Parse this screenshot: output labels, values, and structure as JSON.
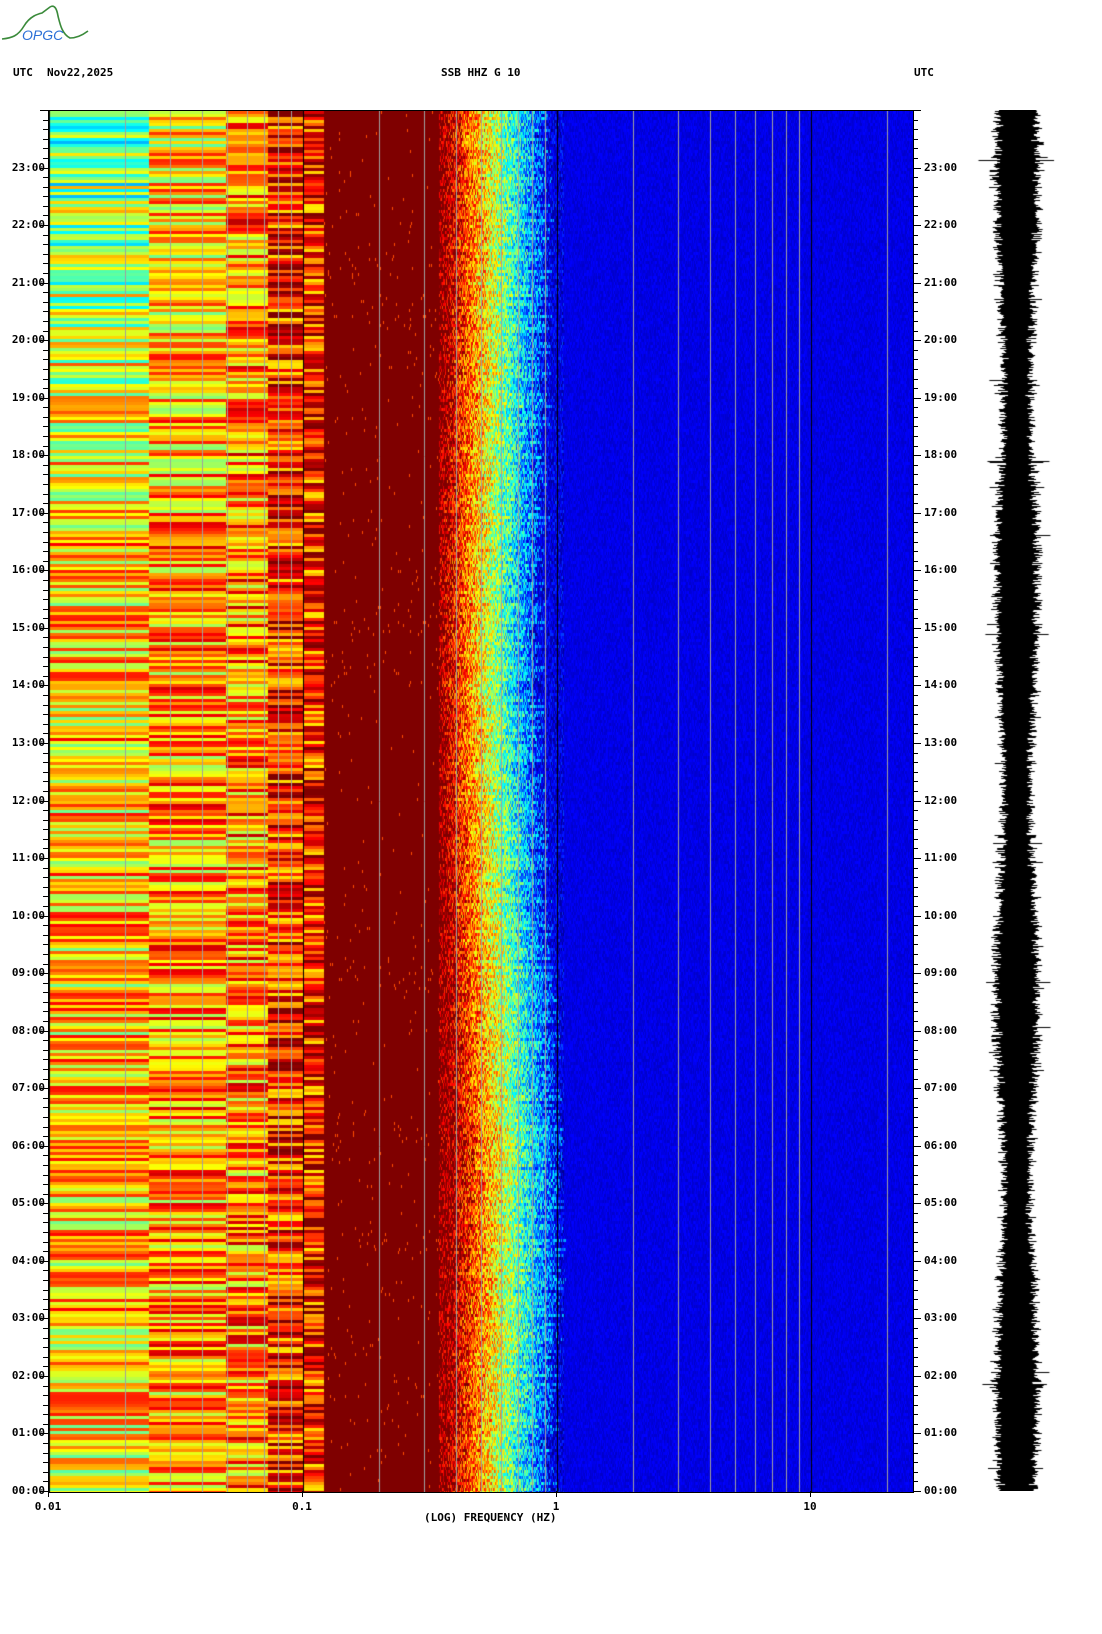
{
  "logo": {
    "text": "OPGC"
  },
  "header": {
    "left_tz": "UTC",
    "date": "Nov22,2025",
    "title": "SSB HHZ G 10",
    "right_tz": "UTC"
  },
  "colors": {
    "low": "#00008f",
    "high": "#800000",
    "trace": "#000000"
  },
  "chart_data": {
    "type": "heatmap",
    "title": "SSB HHZ G 10",
    "date": "Nov22,2025",
    "xlabel": "(LOG) FREQUENCY (HZ)",
    "ylabel": "UTC",
    "xscale": "log",
    "xlim": [
      0.01,
      25
    ],
    "ylim_hours": [
      0,
      24
    ],
    "x_ticks": [
      {
        "value": 0.01,
        "label": "0.01"
      },
      {
        "value": 0.1,
        "label": "0.1"
      },
      {
        "value": 1,
        "label": "1"
      },
      {
        "value": 10,
        "label": "10"
      }
    ],
    "y_ticks": [
      {
        "hour": 0,
        "label": "00:00"
      },
      {
        "hour": 1,
        "label": "01:00"
      },
      {
        "hour": 2,
        "label": "02:00"
      },
      {
        "hour": 3,
        "label": "03:00"
      },
      {
        "hour": 4,
        "label": "04:00"
      },
      {
        "hour": 5,
        "label": "05:00"
      },
      {
        "hour": 6,
        "label": "06:00"
      },
      {
        "hour": 7,
        "label": "07:00"
      },
      {
        "hour": 8,
        "label": "08:00"
      },
      {
        "hour": 9,
        "label": "09:00"
      },
      {
        "hour": 10,
        "label": "10:00"
      },
      {
        "hour": 11,
        "label": "11:00"
      },
      {
        "hour": 12,
        "label": "12:00"
      },
      {
        "hour": 13,
        "label": "13:00"
      },
      {
        "hour": 14,
        "label": "14:00"
      },
      {
        "hour": 15,
        "label": "15:00"
      },
      {
        "hour": 16,
        "label": "16:00"
      },
      {
        "hour": 17,
        "label": "17:00"
      },
      {
        "hour": 18,
        "label": "18:00"
      },
      {
        "hour": 19,
        "label": "19:00"
      },
      {
        "hour": 20,
        "label": "20:00"
      },
      {
        "hour": 21,
        "label": "21:00"
      },
      {
        "hour": 22,
        "label": "22:00"
      },
      {
        "hour": 23,
        "label": "23:00"
      }
    ],
    "colormap": "jet",
    "description_bands": [
      {
        "f_range": [
          0.01,
          0.024
        ],
        "level": 0.55
      },
      {
        "f_range": [
          0.024,
          0.07
        ],
        "level": 0.7
      },
      {
        "f_range": [
          0.07,
          0.12
        ],
        "level": 0.82
      },
      {
        "f_range": [
          0.12,
          0.3
        ],
        "level": 1.0
      },
      {
        "f_range": [
          0.3,
          0.9
        ],
        "level_from": 1.0,
        "level_to": 0.1
      },
      {
        "f_range": [
          0.9,
          25
        ],
        "level": 0.07
      }
    ]
  }
}
